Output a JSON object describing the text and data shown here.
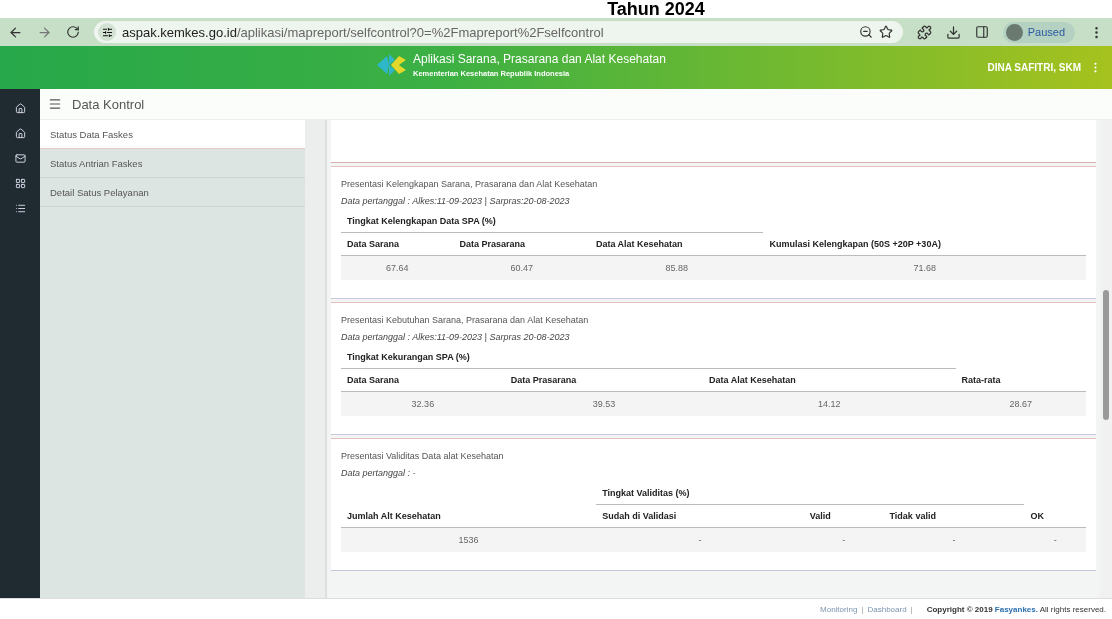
{
  "page_title": "Tahun 2024",
  "browser": {
    "url_host": "aspak.kemkes.go.id",
    "url_path": "/aplikasi/mapreport/selfcontrol?0=%2Fmapreport%2Fselfcontrol",
    "profile": "Paused"
  },
  "header": {
    "title": "Aplikasi Sarana, Prasarana dan Alat Kesehatan",
    "subtitle": "Kementerian Kesehatan Republik Indonesia",
    "user": "DINA SAFITRI, SKM"
  },
  "toolbar": {
    "title": "Data Kontrol"
  },
  "sidebar": {
    "items": [
      {
        "label": "Status Data Faskes",
        "selected": true
      },
      {
        "label": "Status Antrian Faskes",
        "selected": false
      },
      {
        "label": "Detail Satus Pelayanan",
        "selected": false
      }
    ]
  },
  "cards": [
    {
      "title": "Presentasi Kelengkapan Sarana, Prasarana dan Alat Kesehatan",
      "date": "Data pertanggal : Alkes:11-09-2023 | Sarpras:20-08-2023",
      "group": "Tingkat Kelengkapan Data SPA (%)",
      "columns": [
        {
          "label": "Data Sarana",
          "grouped": true
        },
        {
          "label": "Data Prasarana",
          "grouped": true
        },
        {
          "label": "Data Alat Kesehatan",
          "grouped": true
        },
        {
          "label": "Kumulasi Kelengkapan (50S +20P +30A)",
          "grouped": false
        }
      ],
      "rows": [
        [
          "67.64",
          "60.47",
          "85.88",
          "71.68"
        ]
      ]
    },
    {
      "title": "Presentasi Kebutuhan Sarana, Prasarana dan Alat Kesehatan",
      "date": "Data pertanggal : Alkes:11-09-2023 | Sarpras 20-08-2023",
      "group": "Tingkat Kekurangan SPA (%)",
      "columns": [
        {
          "label": "Data Sarana",
          "grouped": true
        },
        {
          "label": "Data Prasarana",
          "grouped": true
        },
        {
          "label": "Data Alat Kesehatan",
          "grouped": true
        },
        {
          "label": "Rata-rata",
          "grouped": false
        }
      ],
      "rows": [
        [
          "32.36",
          "39.53",
          "14.12",
          "28.67"
        ]
      ]
    },
    {
      "title": "Presentasi Validitas Data alat Kesehatan",
      "date": "Data pertanggal : -",
      "group": "Tingkat Validitas (%)",
      "columns": [
        {
          "label": "Jumlah Alt Kesehatan",
          "grouped": false
        },
        {
          "label": "Sudah di Validasi",
          "grouped": true
        },
        {
          "label": "Valid",
          "grouped": true
        },
        {
          "label": "Tidak valid",
          "grouped": true
        },
        {
          "label": "OK",
          "grouped": false
        }
      ],
      "rows": [
        [
          "1536",
          "-",
          "-",
          "-",
          "-"
        ]
      ]
    }
  ],
  "footer": {
    "links": [
      {
        "label": "Monitoring",
        "separator": "|"
      },
      {
        "label": "Dashboard",
        "separator": "|"
      }
    ],
    "copyright": "Copyright © 2019",
    "brand": "Fasyankes.",
    "rights": "All rights reserved."
  }
}
